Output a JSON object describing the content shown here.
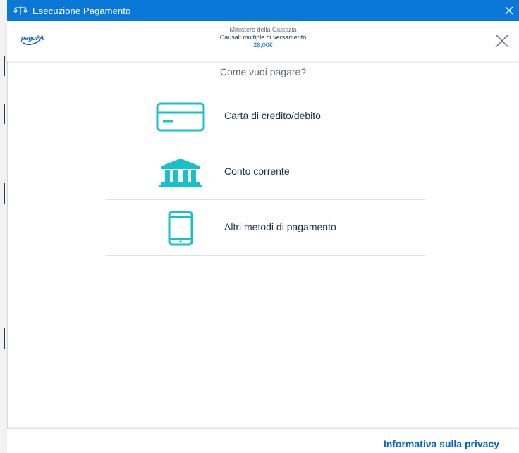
{
  "window": {
    "title": "Esecuzione Pagamento",
    "close_icon": "close-icon",
    "app_icon": "scales-icon",
    "titlebar_color": "#0a78d7"
  },
  "header": {
    "logo_text": "pagoPA",
    "organization": "Ministero della Giustizia",
    "description": "Causali multiple di versamento",
    "amount": "28,00€",
    "close_icon": "close-icon"
  },
  "main": {
    "question": "Come vuoi pagare?",
    "accent_color": "#17c1c8",
    "methods": [
      {
        "label": "Carta di credito/debito",
        "icon": "credit-card-icon"
      },
      {
        "label": "Conto corrente",
        "icon": "bank-icon"
      },
      {
        "label": "Altri metodi di pagamento",
        "icon": "smartphone-icon"
      }
    ]
  },
  "footer": {
    "privacy_link": "Informativa sulla privacy",
    "link_color": "#0066cc"
  }
}
